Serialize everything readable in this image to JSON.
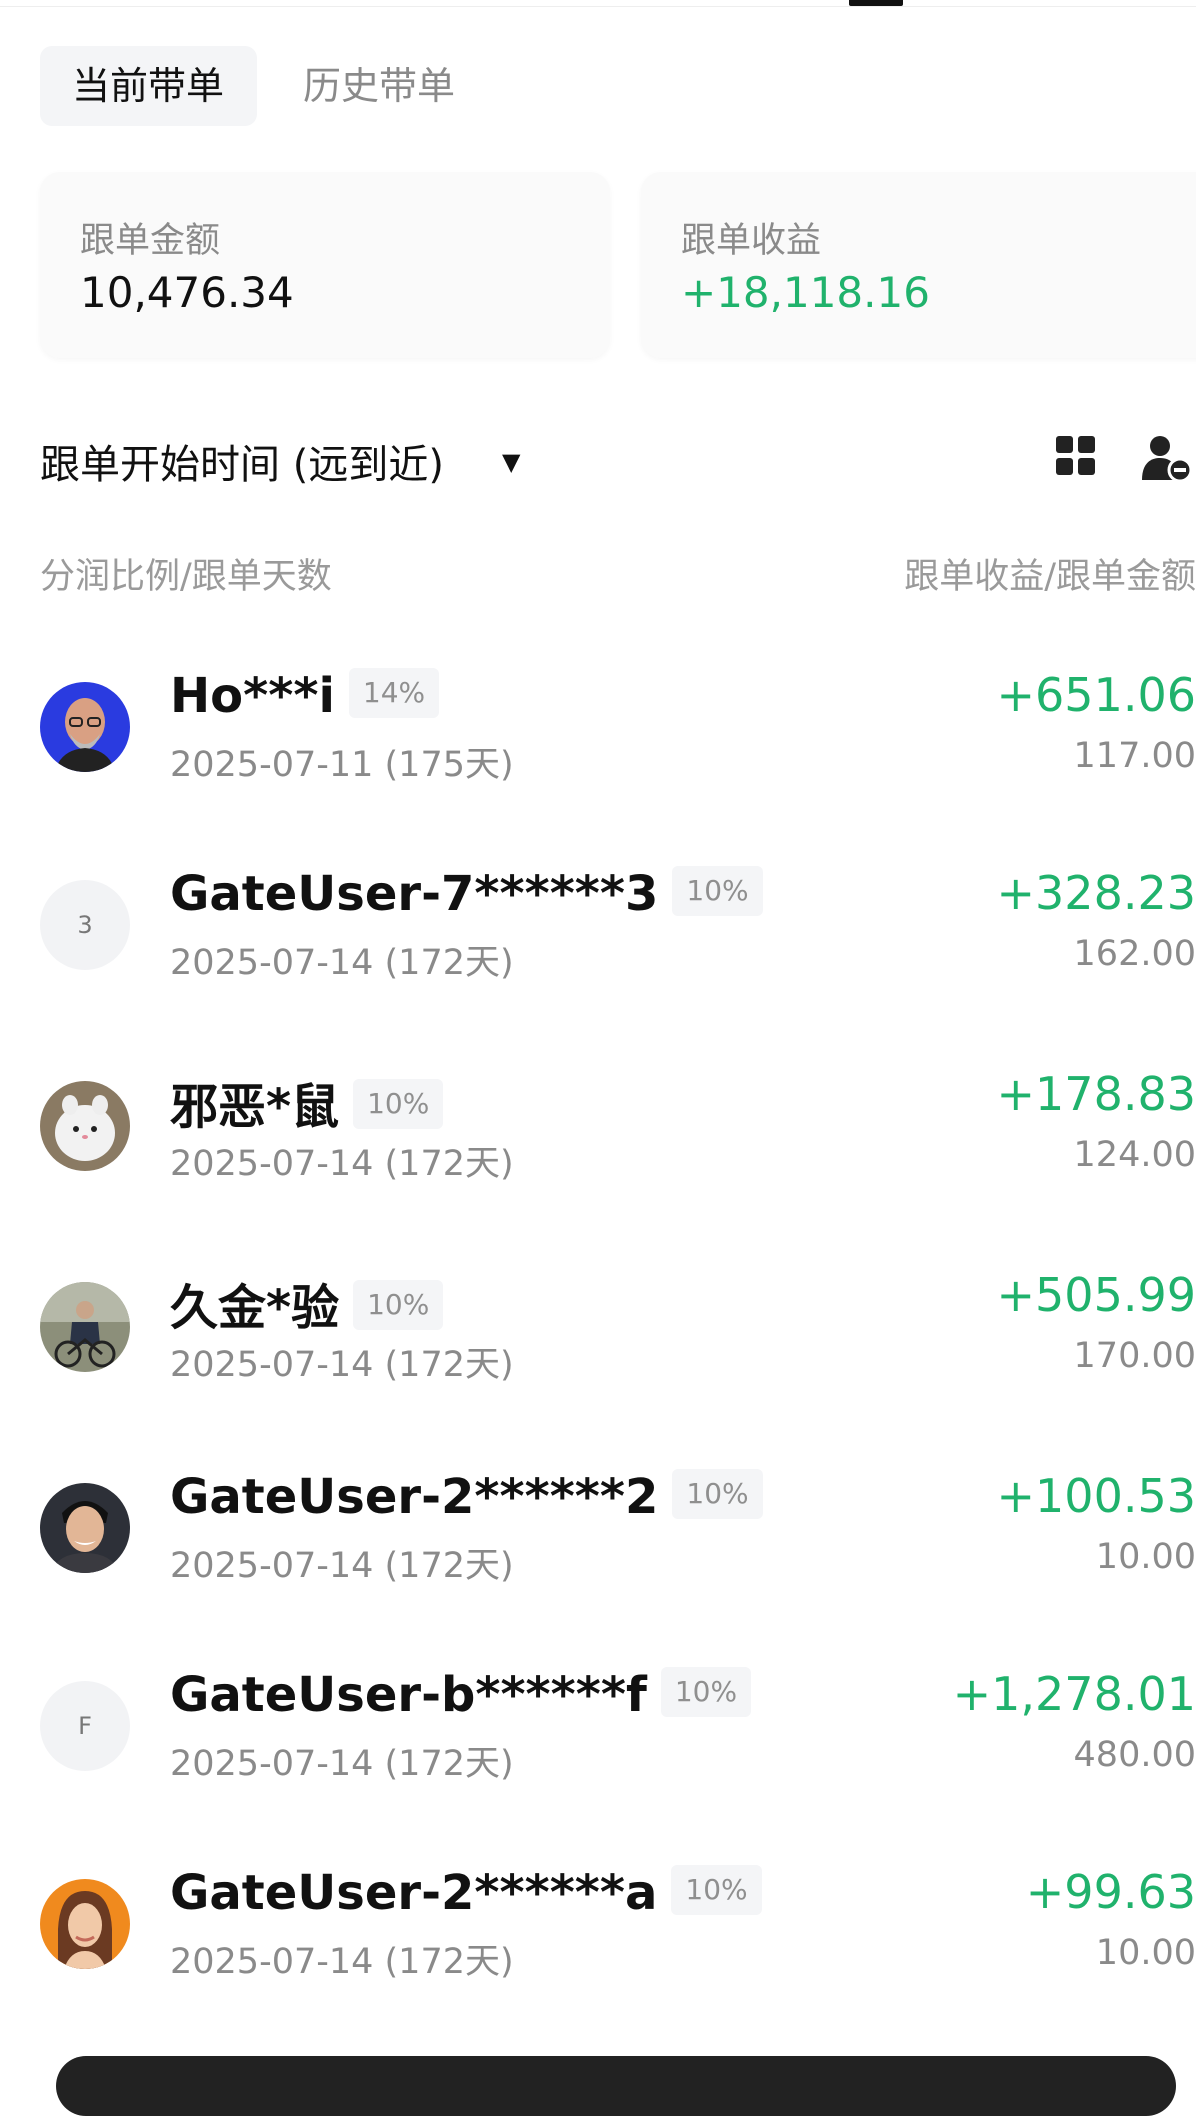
{
  "tabs": [
    {
      "label": "当前带单",
      "active": true
    },
    {
      "label": "历史带单",
      "active": false
    }
  ],
  "summary": {
    "amount_label": "跟单金额",
    "amount_value": "10,476.34",
    "profit_label": "跟单收益",
    "profit_value": "+18,118.16"
  },
  "sort": {
    "label": "跟单开始时间 (远到近)",
    "caret_icon": "caret-down-icon",
    "grid_icon": "grid-view-icon",
    "user_icon": "user-remove-icon"
  },
  "columns": {
    "left": "分润比例/跟单天数",
    "right": "跟单收益/跟单金额"
  },
  "colors": {
    "positive": "#20b26c",
    "muted": "#8a8a8a",
    "primary_text": "#111111"
  },
  "followers": [
    {
      "name": "Ho***i",
      "share": "14%",
      "date": "2025-07-11 (175天)",
      "profit": "+651.06",
      "amount": "117.00",
      "avatar": "photo"
    },
    {
      "name": "GateUser-7******3",
      "share": "10%",
      "date": "2025-07-14 (172天)",
      "profit": "+328.23",
      "amount": "162.00",
      "avatar_letter": "3"
    },
    {
      "name": "邪恶*鼠",
      "share": "10%",
      "date": "2025-07-14 (172天)",
      "profit": "+178.83",
      "amount": "124.00",
      "avatar": "photo"
    },
    {
      "name": "久金*验",
      "share": "10%",
      "date": "2025-07-14 (172天)",
      "profit": "+505.99",
      "amount": "170.00",
      "avatar": "photo"
    },
    {
      "name": "GateUser-2******2",
      "share": "10%",
      "date": "2025-07-14 (172天)",
      "profit": "+100.53",
      "amount": "10.00",
      "avatar": "photo"
    },
    {
      "name": "GateUser-b******f",
      "share": "10%",
      "date": "2025-07-14 (172天)",
      "profit": "+1,278.01",
      "amount": "480.00",
      "avatar_letter": "F"
    },
    {
      "name": "GateUser-2******a",
      "share": "10%",
      "date": "2025-07-14 (172天)",
      "profit": "+99.63",
      "amount": "10.00",
      "avatar": "photo"
    }
  ]
}
